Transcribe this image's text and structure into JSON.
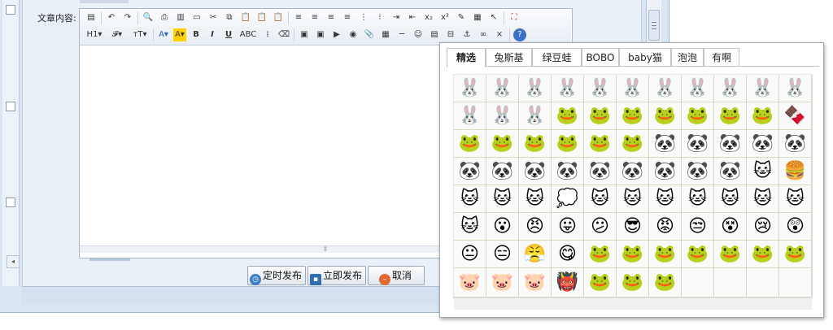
{
  "form": {
    "content_label": "文章内容:"
  },
  "toolbar": {
    "row1": [
      {
        "name": "source-icon",
        "glyph": "▤"
      },
      {
        "sep": true
      },
      {
        "name": "undo-icon",
        "glyph": "↶"
      },
      {
        "name": "redo-icon",
        "glyph": "↷"
      },
      {
        "sep": true
      },
      {
        "name": "preview-icon",
        "glyph": "🔍"
      },
      {
        "name": "print-icon",
        "glyph": "⎙"
      },
      {
        "name": "template-icon",
        "glyph": "▥"
      },
      {
        "name": "code-icon",
        "glyph": "▭"
      },
      {
        "name": "cut-icon",
        "glyph": "✂"
      },
      {
        "name": "copy-icon",
        "glyph": "⧉"
      },
      {
        "name": "paste-icon",
        "glyph": "📋"
      },
      {
        "name": "paste-plain-icon",
        "glyph": "📋"
      },
      {
        "name": "paste-word-icon",
        "glyph": "📋"
      },
      {
        "sep": true
      },
      {
        "name": "align-left-icon",
        "glyph": "≡"
      },
      {
        "name": "align-center-icon",
        "glyph": "≡"
      },
      {
        "name": "align-right-icon",
        "glyph": "≡"
      },
      {
        "name": "align-justify-icon",
        "glyph": "≡"
      },
      {
        "name": "ordered-list-icon",
        "glyph": "⋮"
      },
      {
        "name": "unordered-list-icon",
        "glyph": "⁝"
      },
      {
        "name": "indent-icon",
        "glyph": "⇥"
      },
      {
        "name": "outdent-icon",
        "glyph": "⇤"
      },
      {
        "name": "subscript-icon",
        "glyph": "x₂"
      },
      {
        "name": "superscript-icon",
        "glyph": "x²"
      },
      {
        "name": "clear-format-icon",
        "glyph": "✎"
      },
      {
        "name": "select-all-icon",
        "glyph": "▦"
      },
      {
        "name": "cursor-icon",
        "glyph": "↖"
      },
      {
        "sep": true
      },
      {
        "name": "fullscreen-icon",
        "glyph": "⛶"
      }
    ],
    "row2": [
      {
        "name": "heading-icon",
        "glyph": "H1▾"
      },
      {
        "name": "font-family-icon",
        "glyph": "𝓕▾"
      },
      {
        "name": "font-size-icon",
        "glyph": "тT▾"
      },
      {
        "sep": true
      },
      {
        "name": "font-color-icon",
        "glyph": "A▾"
      },
      {
        "name": "highlight-icon",
        "glyph": "A▾"
      },
      {
        "name": "bold-icon",
        "glyph": "B"
      },
      {
        "name": "italic-icon",
        "glyph": "I"
      },
      {
        "name": "underline-icon",
        "glyph": "U"
      },
      {
        "name": "strikethrough-icon",
        "glyph": "ABC"
      },
      {
        "name": "line-height-icon",
        "glyph": "⁞"
      },
      {
        "name": "remove-format-icon",
        "glyph": "⌫"
      },
      {
        "sep": true
      },
      {
        "name": "image-icon",
        "glyph": "▣"
      },
      {
        "name": "multi-image-icon",
        "glyph": "▣"
      },
      {
        "name": "flash-icon",
        "glyph": "▶"
      },
      {
        "name": "media-icon",
        "glyph": "◉"
      },
      {
        "name": "attachment-icon",
        "glyph": "📎"
      },
      {
        "name": "table-icon",
        "glyph": "▦"
      },
      {
        "name": "hr-icon",
        "glyph": "─"
      },
      {
        "name": "emoticon-icon",
        "glyph": "☺"
      },
      {
        "name": "map-icon",
        "glyph": "▤"
      },
      {
        "name": "pagebreak-icon",
        "glyph": "⊟"
      },
      {
        "name": "anchor-icon",
        "glyph": "⚓"
      },
      {
        "name": "link-icon",
        "glyph": "∞"
      },
      {
        "name": "unlink-icon",
        "glyph": "⨯"
      },
      {
        "sep": true
      },
      {
        "name": "help-icon",
        "glyph": "?"
      }
    ]
  },
  "buttons": {
    "schedule": "定时发布",
    "publish_now": "立即发布",
    "cancel": "取消"
  },
  "emoticon_tabs": [
    "精选",
    "兔斯基",
    "绿豆蛙",
    "BOBO",
    "baby猫",
    "泡泡",
    "有啊"
  ],
  "active_tab": "精选",
  "emoticons": [
    [
      "🐰",
      "🐰",
      "🐰",
      "🐰",
      "🐰",
      "🐰",
      "🐰",
      "🐰",
      "🐰",
      "🐰",
      "🐰"
    ],
    [
      "🐰",
      "🐰",
      "🐰",
      "🐸",
      "🐸",
      "🐸",
      "🐸",
      "🐸",
      "🐸",
      "🐸",
      "🍫"
    ],
    [
      "🐸",
      "🐸",
      "🐸",
      "🐸",
      "🐸",
      "🐸",
      "🐼",
      "🐼",
      "🐼",
      "🐼",
      "🐼"
    ],
    [
      "🐼",
      "🐼",
      "🐼",
      "🐼",
      "🐼",
      "🐼",
      "🐼",
      "🐼",
      "🐼",
      "🐱",
      "🍔"
    ],
    [
      "🐱",
      "🐱",
      "🐱",
      "💭",
      "🐱",
      "🐱",
      "🐱",
      "🐱",
      "🐱",
      "🐱",
      "🐱"
    ],
    [
      "🐱",
      "😮",
      "😠",
      "😛",
      "😕",
      "😎",
      "😡",
      "😒",
      "😵",
      "😢",
      "😲"
    ],
    [
      "😐",
      "😑",
      "😤",
      "😋",
      "🐸",
      "🐸",
      "🐸",
      "🐸",
      "🐸",
      "🐸",
      "🐸"
    ],
    [
      "🐷",
      "🐷",
      "🐷",
      "👹",
      "🐸",
      "🐸",
      "🐸",
      "",
      "",
      "",
      ""
    ]
  ]
}
